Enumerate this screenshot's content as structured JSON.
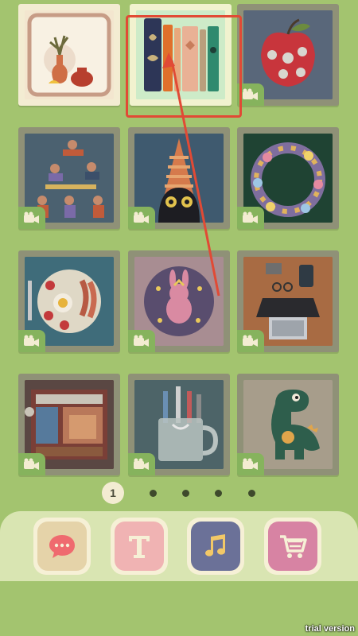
{
  "app": {
    "watermark": "trial version"
  },
  "colors": {
    "background": "#a3c46f",
    "tile_frame": "#8f9177",
    "camera_badge": "#86b35d",
    "selection": "#e14a35",
    "dock": "#d9e5b2"
  },
  "puzzles": [
    {
      "name": "vases",
      "status": "unlocked",
      "has_video": false
    },
    {
      "name": "books",
      "status": "selected",
      "has_video": false
    },
    {
      "name": "apple",
      "status": "locked",
      "has_video": true
    },
    {
      "name": "acrobats",
      "status": "locked",
      "has_video": true
    },
    {
      "name": "black-cat",
      "status": "locked",
      "has_video": true
    },
    {
      "name": "flower-wreath",
      "status": "locked",
      "has_video": true
    },
    {
      "name": "breakfast",
      "status": "locked",
      "has_video": true
    },
    {
      "name": "bunny-plate",
      "status": "locked",
      "has_video": true
    },
    {
      "name": "desk-laptop",
      "status": "locked",
      "has_video": true
    },
    {
      "name": "room",
      "status": "locked",
      "has_video": true
    },
    {
      "name": "toothbrush-cup",
      "status": "locked",
      "has_video": true
    },
    {
      "name": "dinosaur",
      "status": "locked",
      "has_video": true
    }
  ],
  "pager": {
    "current": "1",
    "total_pages": 5
  },
  "dock": [
    {
      "icon": "chat-bubble-icon",
      "color": "#ef6a6f",
      "bg": "#e5d3a9"
    },
    {
      "icon": "text-icon",
      "color": "#f6f0d6",
      "bg": "#f0b3b3"
    },
    {
      "icon": "music-note-icon",
      "color": "#f2c867",
      "bg": "#6b7198"
    },
    {
      "icon": "shopping-cart-icon",
      "color": "#f6f0d6",
      "bg": "#d783a3"
    }
  ]
}
